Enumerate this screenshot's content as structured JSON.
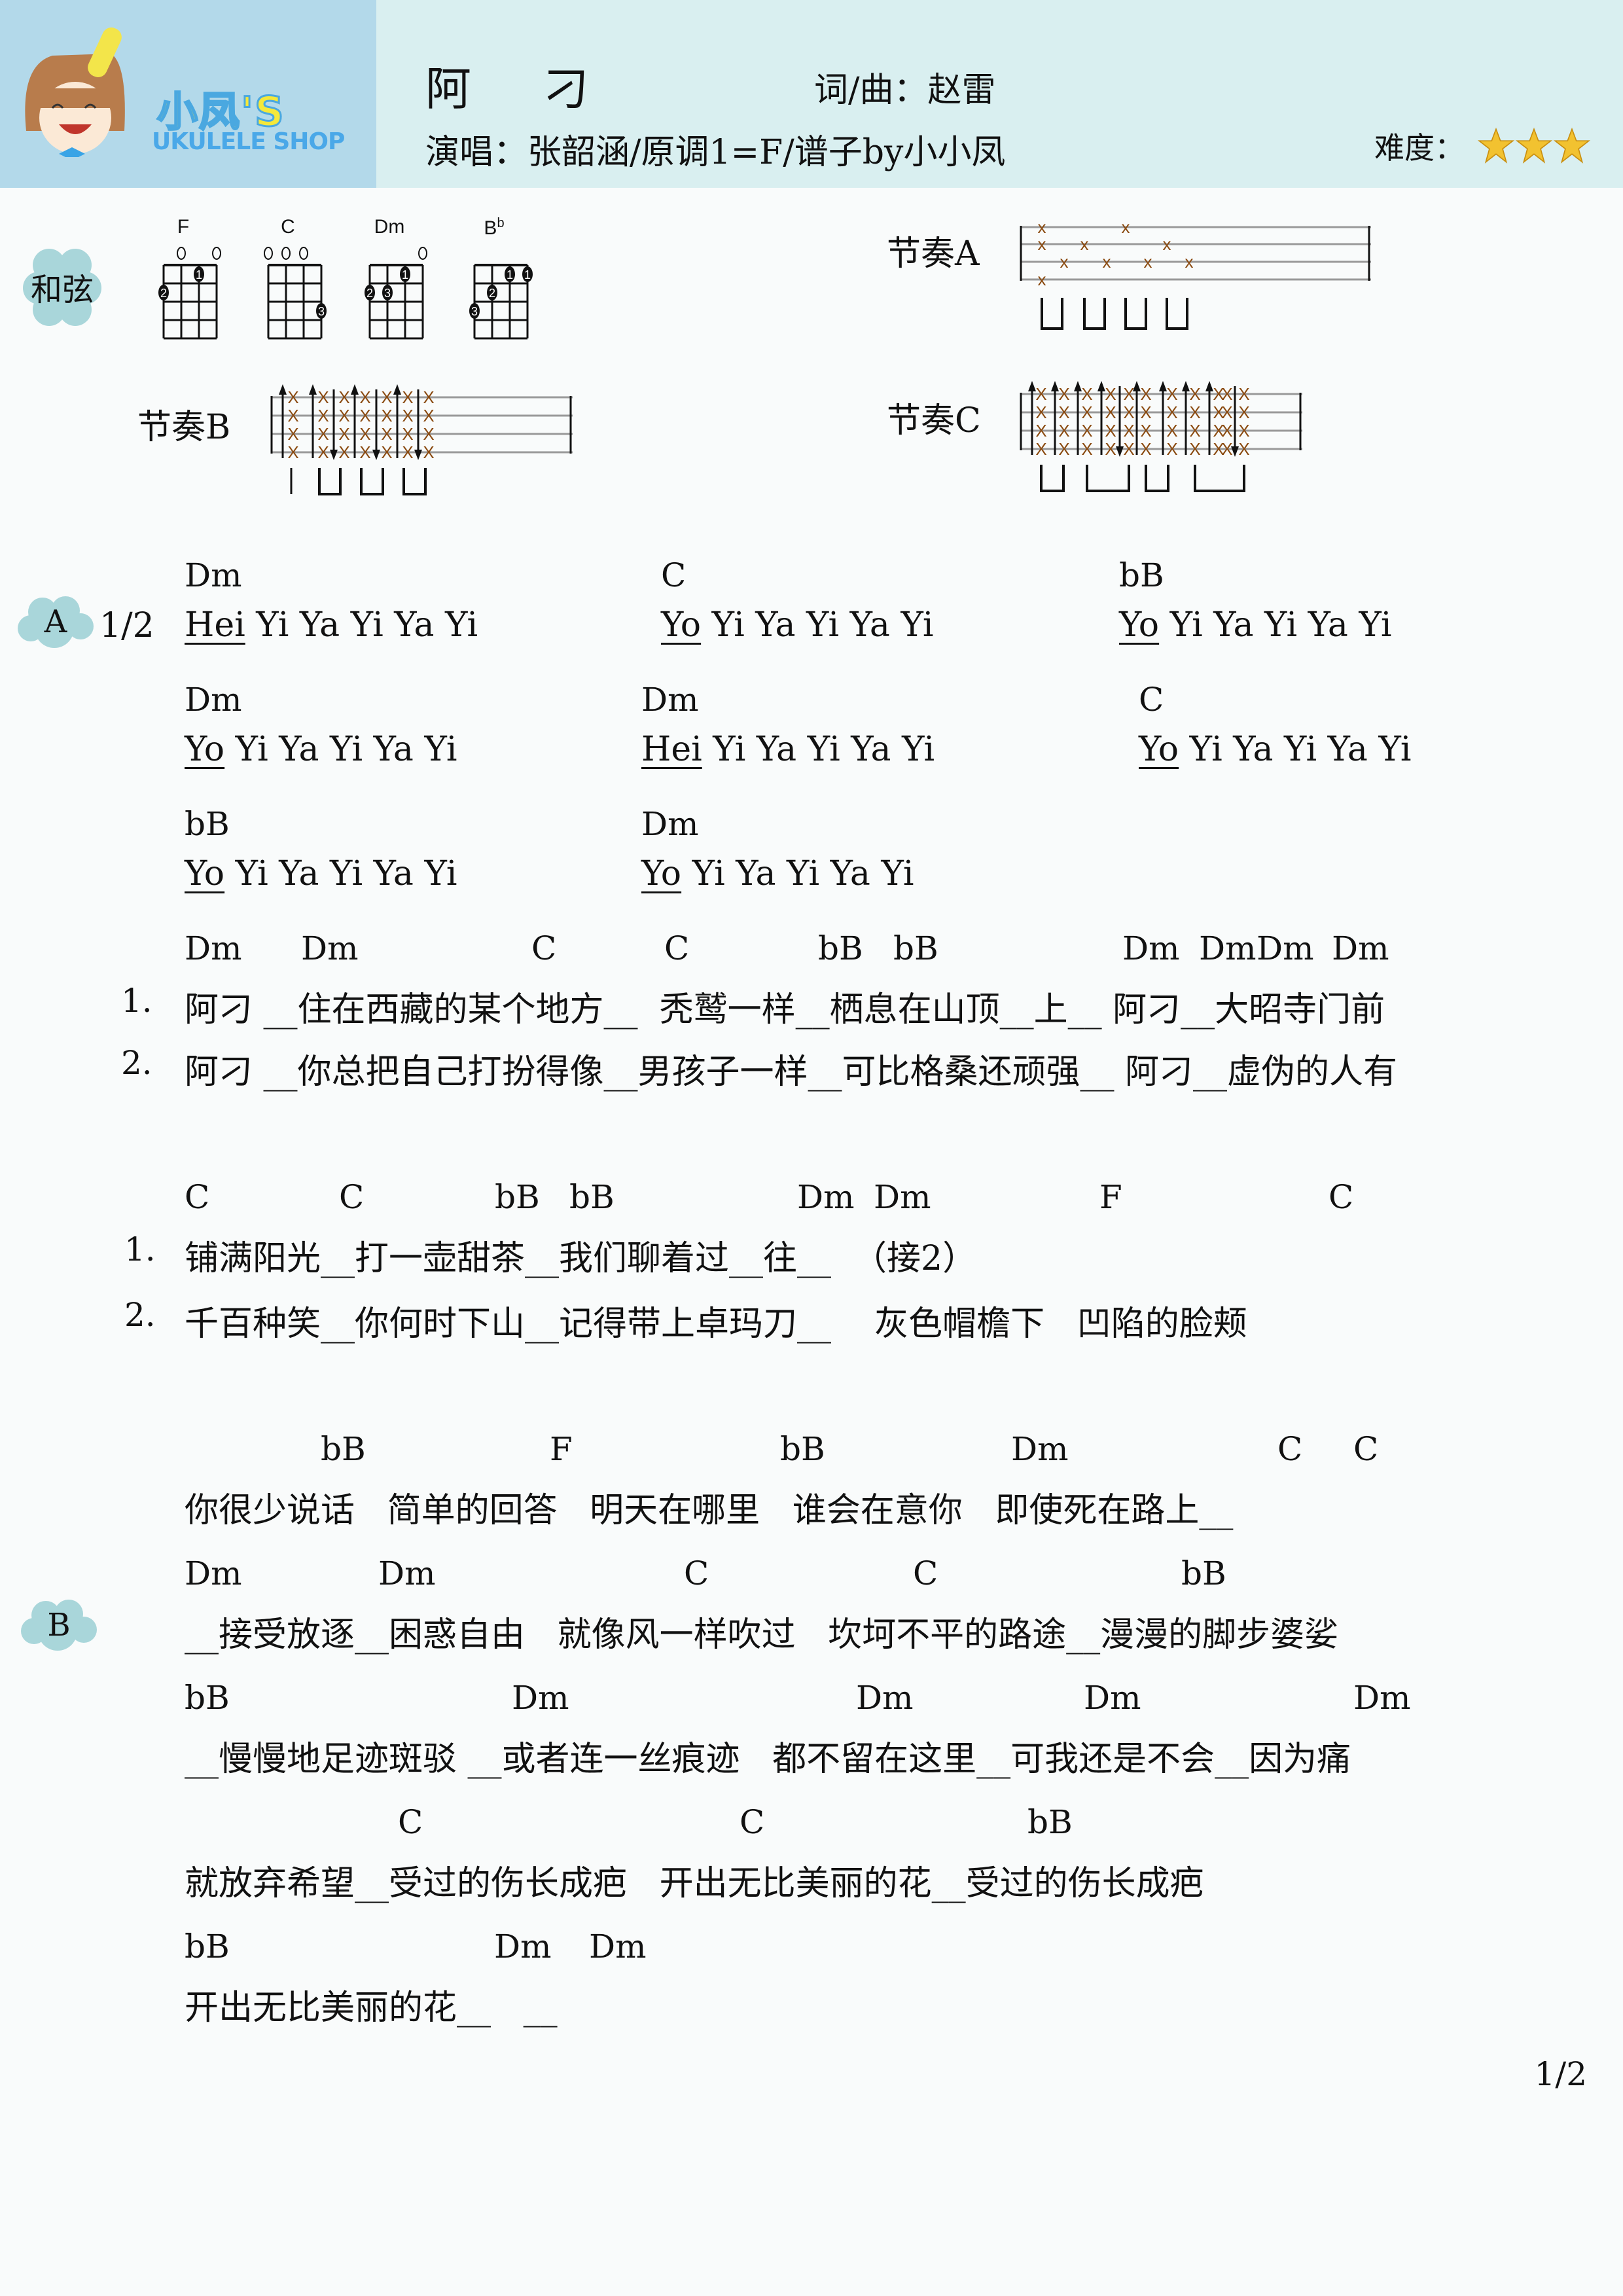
{
  "header": {
    "logo": {
      "cn": "小凤'S",
      "en": "UKULELE SHOP"
    },
    "title": "阿刁",
    "composer": "词/曲：赵雷",
    "singer": "演唱：张韶涵/原调1=F/谱子by小小凤",
    "difficulty_label": "难度：",
    "difficulty_stars": 3,
    "difficulty_max": 3
  },
  "chords_section": {
    "label": "和弦",
    "chords": [
      {
        "name": "F",
        "open": [
          1,
          3
        ],
        "dots": [
          {
            "string": 2,
            "fret": 1,
            "finger": "1"
          },
          {
            "string": 0,
            "fret": 2,
            "finger": "2"
          }
        ]
      },
      {
        "name": "C",
        "open": [
          0,
          1,
          2
        ],
        "dots": [
          {
            "string": 3,
            "fret": 3,
            "finger": "3"
          }
        ]
      },
      {
        "name": "Dm",
        "open": [
          3
        ],
        "dots": [
          {
            "string": 2,
            "fret": 1,
            "finger": "1"
          },
          {
            "string": 0,
            "fret": 2,
            "finger": "2"
          },
          {
            "string": 1,
            "fret": 2,
            "finger": "3"
          }
        ]
      },
      {
        "name": "B",
        "sup": "b",
        "open": [],
        "dots": [
          {
            "string": 2,
            "fret": 1,
            "finger": "1"
          },
          {
            "string": 3,
            "fret": 1,
            "finger": "1"
          },
          {
            "string": 1,
            "fret": 2,
            "finger": "2"
          },
          {
            "string": 0,
            "fret": 3,
            "finger": "3"
          }
        ]
      }
    ]
  },
  "rhythms": {
    "a_label": "节奏A",
    "b_label": "节奏B",
    "c_label": "节奏C"
  },
  "sections": {
    "a_marker": "A",
    "a_repeat": "1/2",
    "b_marker": "B"
  },
  "intro_lines": [
    [
      {
        "chord": "Dm",
        "lead": "Hei",
        "rest": " Yi Ya Yi Ya Yi"
      },
      {
        "chord": "C",
        "lead": "Yo",
        "rest": " Yi Ya Yi Ya Yi"
      },
      {
        "chord": "bB",
        "lead": "Yo",
        "rest": " Yi Ya Yi Ya Yi"
      }
    ],
    [
      {
        "chord": "Dm",
        "lead": "Yo",
        "rest": " Yi Ya Yi Ya Yi"
      },
      {
        "chord": "Dm",
        "lead": "Hei",
        "rest": " Yi Ya Yi Ya Yi"
      },
      {
        "chord": "C",
        "lead": "Yo",
        "rest": " Yi Ya Yi Ya Yi"
      }
    ],
    [
      {
        "chord": "bB",
        "lead": "Yo",
        "rest": " Yi Ya Yi Ya Yi"
      },
      {
        "chord": "Dm",
        "lead": "Yo",
        "rest": " Yi Ya Yi Ya Yi"
      }
    ]
  ],
  "verse1": {
    "chords": [
      "Dm",
      "Dm",
      "C",
      "C",
      "bB",
      "bB",
      "Dm",
      "Dm",
      "Dm",
      "Dm"
    ],
    "line1_num": "1.",
    "line1": "阿刁 __住在西藏的某个地方__  秃鹫一样__栖息在山顶__上__ 阿刁__大昭寺门前",
    "line2_num": "2.",
    "line2": "阿刁 __你总把自己打扮得像__男孩子一样__可比格桑还顽强__ 阿刁__虚伪的人有"
  },
  "verse2": {
    "chords": [
      "C",
      "C",
      "bB",
      "bB",
      "Dm",
      "Dm",
      "F",
      "C"
    ],
    "line1_num": "1.",
    "line1": "铺满阳光__打一壶甜茶__我们聊着过__往__  （接2）",
    "line2_num": "2.",
    "line2": "千百种笑__你何时下山__记得带上卓玛刀__    灰色帽檐下   凹陷的脸颊"
  },
  "bridge": {
    "chords": [
      "bB",
      "F",
      "bB",
      "Dm",
      "C",
      "C"
    ],
    "line": "你很少说话   简单的回答   明天在哪里   谁会在意你   即使死在路上__"
  },
  "chorus": [
    {
      "chords": [
        "Dm",
        "Dm",
        "C",
        "C",
        "bB"
      ],
      "line": "__接受放逐__困惑自由   就像风一样吹过   坎坷不平的路途__漫漫的脚步婆娑"
    },
    {
      "chords": [
        "bB",
        "Dm",
        "Dm",
        "Dm",
        "Dm"
      ],
      "line": "__慢慢地足迹斑驳 __或者连一丝痕迹   都不留在这里__可我还是不会__因为痛"
    },
    {
      "chords": [
        "C",
        "C",
        "bB"
      ],
      "line": "就放弃希望__受过的伤长成疤   开出无比美丽的花__受过的伤长成疤"
    },
    {
      "chords": [
        "bB",
        "Dm",
        "Dm"
      ],
      "line": "开出无比美丽的花__   __"
    }
  ],
  "page_number": "1/2",
  "colors": {
    "header_bg": "#d9eff0",
    "logo_bg": "#b3d9ea",
    "cloud": "#a9d6da",
    "star": "#f2c230"
  }
}
